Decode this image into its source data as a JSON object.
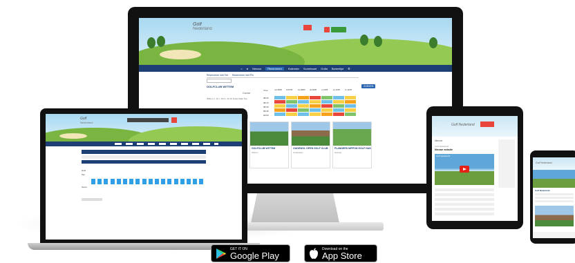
{
  "desktop": {
    "logo": {
      "line1": "Golf",
      "line2": "Nederland"
    },
    "nav": [
      "Nieuws",
      "Reserveren",
      "Kalender",
      "Scorekaart",
      "Golfa",
      "Banenlijst"
    ],
    "tabs": [
      "Reserveren met Tee",
      "Reserveren met Pin"
    ],
    "club_label": "GOLFCLUB WITTEM",
    "search_btn": "ZOEKEN",
    "course_header": "Course",
    "course_name": "Wittem 1: 10 + 10 9 + 10 10 Holes Wijer Tee",
    "row_labels": [
      "Time",
      "08:00",
      "08:15",
      "08:30",
      "08:45",
      "09:00"
    ],
    "day_headers": [
      "ma 06/05",
      "di 07/05",
      "wo 08/05",
      "do 09/05",
      "vr 10/05",
      "za 11/05",
      "zo 12/05"
    ],
    "cards": [
      {
        "title": "GOLFCLUB WITTEM",
        "sub": "Wittem"
      },
      {
        "title": "OUDEWOL OPEN GOLF CLUB",
        "sub": "Oudewater"
      },
      {
        "title": "FLANDERS NIPPON GOLF HASSELT",
        "sub": "Hasselt"
      }
    ]
  },
  "laptop": {
    "logo": {
      "line1": "Golf",
      "line2": "Nederland"
    },
    "title_bar": "Scorekaart",
    "hole_label": "Hole",
    "par_label": "Par",
    "score_label": "Score"
  },
  "tablet": {
    "logo": "Golf Nederland",
    "section": "Nieuws",
    "headline": "Golf Nederland",
    "subhead": "Nieuwe website",
    "video_title": "Golf Nederland"
  },
  "phone": {
    "logo": "Golf Nederland",
    "caption": "Golf Nederland"
  },
  "stores": {
    "google": {
      "small": "GET IT ON",
      "big": "Google Play"
    },
    "apple": {
      "small": "Download on the",
      "big": "App Store"
    }
  },
  "colors": {
    "navy": "#1d3f73",
    "accent": "#2b66b0",
    "grass": "#7ab542"
  }
}
